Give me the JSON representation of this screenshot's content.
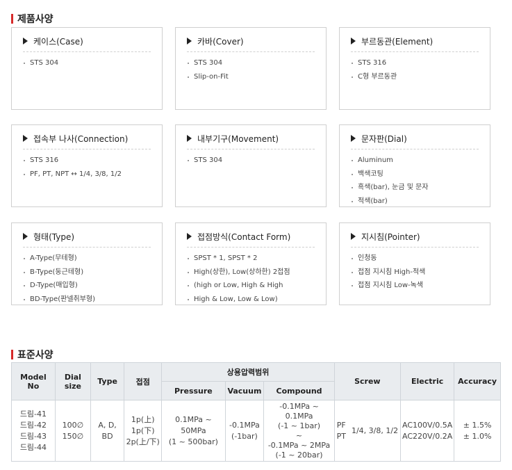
{
  "product_spec": {
    "title": "제품사양",
    "cards": [
      {
        "title": "케이스(Case)",
        "items": [
          "STS 304"
        ]
      },
      {
        "title": "카바(Cover)",
        "items": [
          "STS 304",
          "Slip-on-Fit"
        ]
      },
      {
        "title": "부르동관(Element)",
        "items": [
          "STS 316",
          "C형 부르동관"
        ]
      },
      {
        "title": "접속부 나사(Connection)",
        "items": [
          "STS 316",
          "PF, PT, NPT ↔ 1/4, 3/8, 1/2"
        ]
      },
      {
        "title": "내부기구(Movement)",
        "items": [
          "STS 304"
        ]
      },
      {
        "title": "문자판(Dial)",
        "items": [
          "Aluminum",
          "백색코팅",
          "흑색(bar), 눈금 및 문자",
          "적색(bar)"
        ]
      },
      {
        "title": "형태(Type)",
        "items": [
          "A-Type(무테형)",
          "B-Type(둥근테형)",
          "D-Type(매입형)",
          "BD-Type(판넬취부형)"
        ]
      },
      {
        "title": "접점방식(Contact Form)",
        "items": [
          "SPST * 1, SPST * 2",
          "High(상한), Low(상하한) 2접점",
          "(high or Low, High & High",
          "High & Low, Low & Low)"
        ]
      },
      {
        "title": "지시침(Pointer)",
        "items": [
          "인청동",
          "접점 지시침 High-적색",
          "접점 지시침 Low-녹색"
        ]
      }
    ]
  },
  "standard_spec": {
    "title": "표준사양",
    "headers": {
      "model_no": "Model No",
      "dial_size": "Dial size",
      "type": "Type",
      "contact": "접점",
      "pressure_range": "상용압력범위",
      "pressure": "Pressure",
      "vacuum": "Vacuum",
      "compound": "Compound",
      "screw": "Screw",
      "electric": "Electric",
      "accuracy": "Accuracy"
    },
    "row": {
      "model_no": "드림-41\n드림-42\n드림-43\n드림-44",
      "dial_size": "100∅\n150∅",
      "type": "A, D, BD",
      "contact": "1p(上)\n1p(下)\n2p(上/下)",
      "pressure": "0.1MPa ~ 50MPa\n(1 ~ 500bar)",
      "vacuum": "-0.1MPa\n(-1bar)",
      "compound": "-0.1MPa ~ 0.1MPa\n(-1 ~ 1bar)\n~\n-0.1MPa ~ 2MPa\n(-1 ~ 20bar)",
      "screw_type": "PF\nPT",
      "screw_size": "1/4, 3/8, 1/2",
      "electric": "AC100V/0.5A\nAC220V/0.2A",
      "accuracy": "± 1.5%\n± 1.0%"
    }
  },
  "colors": {
    "accent": "#d62b2b",
    "table_header_bg": "#e9ecef",
    "border": "#cfcfcf"
  }
}
